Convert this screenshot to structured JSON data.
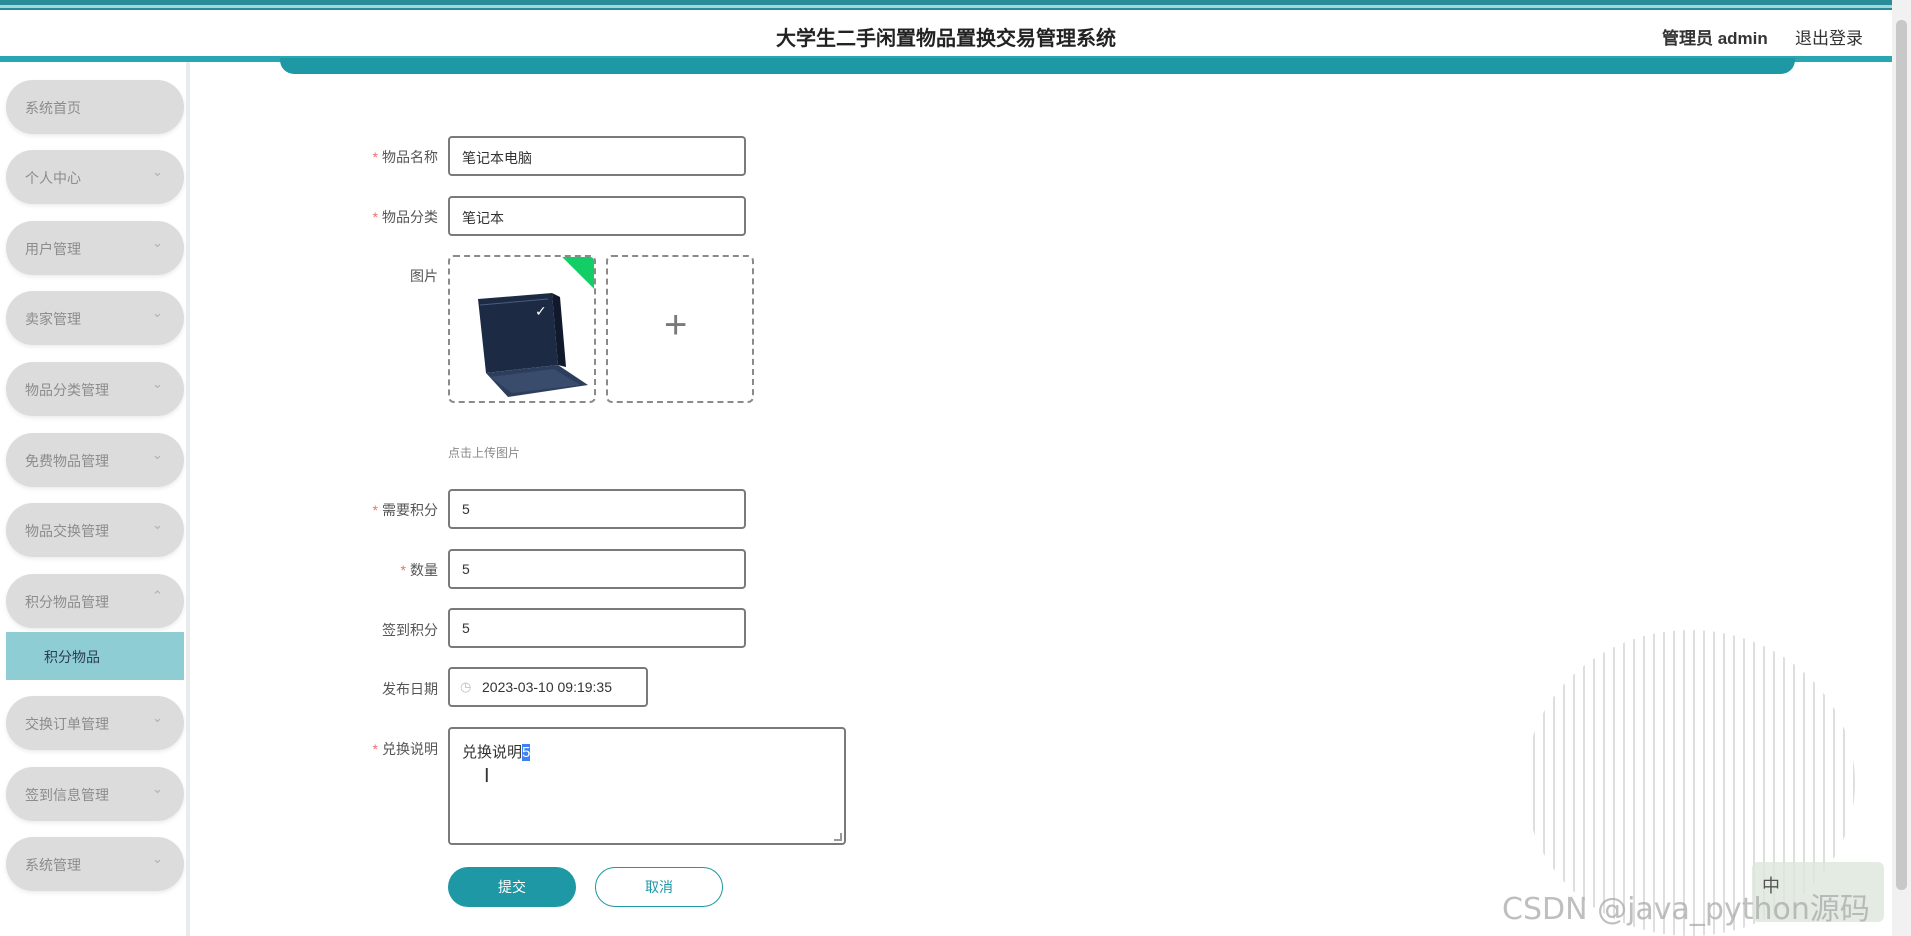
{
  "header": {
    "title": "大学生二手闲置物品置换交易管理系统",
    "user": "管理员 admin",
    "logout": "退出登录"
  },
  "sidebar": {
    "items": [
      {
        "label": "系统首页"
      },
      {
        "label": "个人中心"
      },
      {
        "label": "用户管理"
      },
      {
        "label": "卖家管理"
      },
      {
        "label": "物品分类管理"
      },
      {
        "label": "免费物品管理"
      },
      {
        "label": "物品交换管理"
      },
      {
        "label": "积分物品管理"
      },
      {
        "label": "交换订单管理"
      },
      {
        "label": "签到信息管理"
      },
      {
        "label": "系统管理"
      }
    ],
    "active_sub": "积分物品"
  },
  "form": {
    "name_label": "物品名称",
    "name_value": "笔记本电脑",
    "category_label": "物品分类",
    "category_value": "笔记本",
    "image_label": "图片",
    "upload_hint": "点击上传图片",
    "points_label": "需要积分",
    "points_value": "5",
    "quantity_label": "数量",
    "quantity_value": "5",
    "signin_points_label": "签到积分",
    "signin_points_value": "5",
    "date_label": "发布日期",
    "date_value": "2023-03-10 09:19:35",
    "desc_label": "兑换说明",
    "desc_value": "兑换说明",
    "desc_cursor": "5",
    "required_mark": "*",
    "submit": "提交",
    "cancel": "取消"
  },
  "watermark": "CSDN @java_python源码",
  "ime_label": "中"
}
